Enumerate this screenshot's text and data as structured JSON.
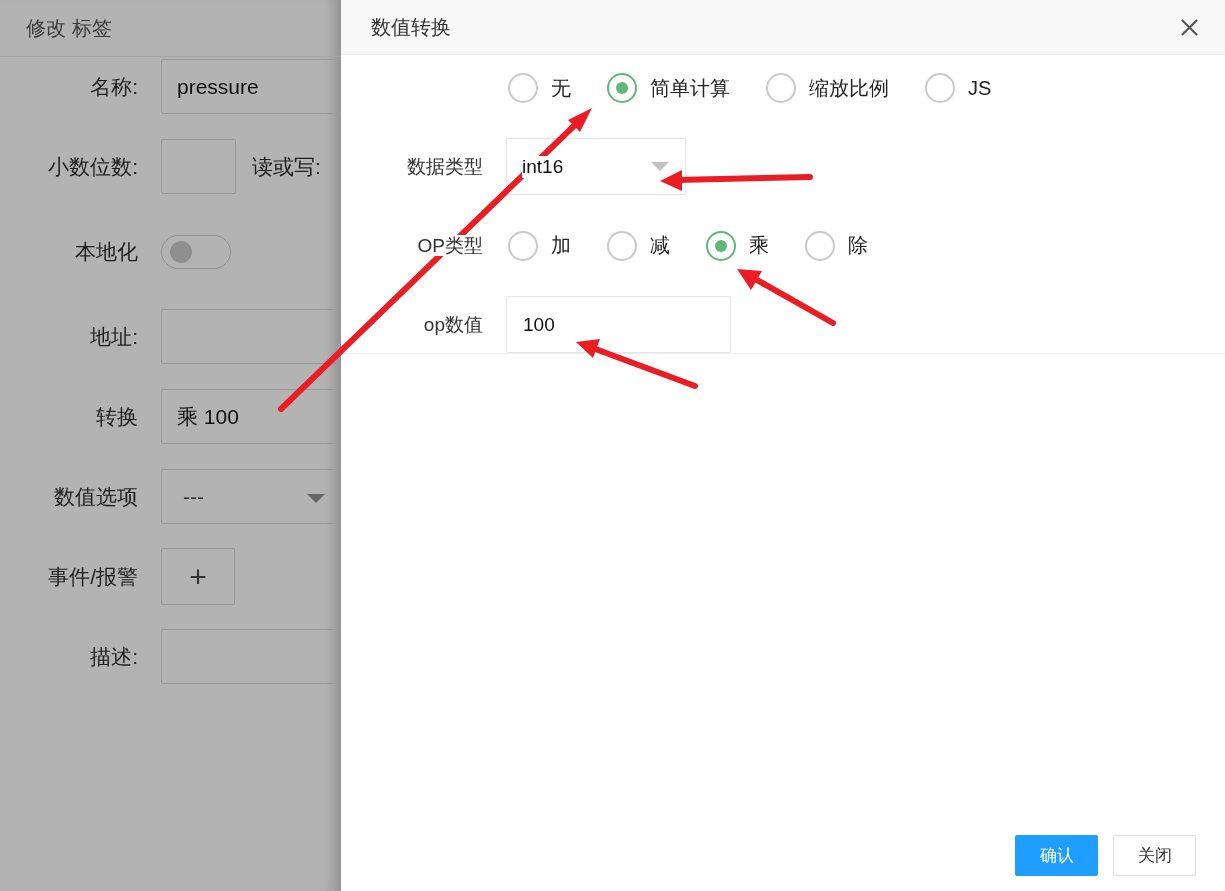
{
  "background_form": {
    "title": "修改 标签",
    "rows": [
      {
        "kind": "input",
        "label": "名称:",
        "value": "pressure"
      },
      {
        "kind": "narrow",
        "label": "小数位数:",
        "side_label": "读或写:"
      },
      {
        "kind": "toggle",
        "label": "本地化",
        "on": false
      },
      {
        "kind": "input",
        "label": "地址:"
      },
      {
        "kind": "input",
        "label": "转换",
        "value": "乘 100"
      },
      {
        "kind": "select",
        "label": "数值选项",
        "value": "---"
      },
      {
        "kind": "add",
        "label": "事件/报警",
        "symbol": "+"
      },
      {
        "kind": "input",
        "label": "描述:"
      }
    ]
  },
  "dialog": {
    "title": "数值转换",
    "modes": [
      {
        "label": "无",
        "selected": false
      },
      {
        "label": "简单计算",
        "selected": true
      },
      {
        "label": "缩放比例",
        "selected": false
      },
      {
        "label": "JS",
        "selected": false
      }
    ],
    "data_type": {
      "label": "数据类型",
      "value": "int16"
    },
    "op_type": {
      "label": "OP类型",
      "options": [
        {
          "label": "加",
          "selected": false
        },
        {
          "label": "减",
          "selected": false
        },
        {
          "label": "乘",
          "selected": true
        },
        {
          "label": "除",
          "selected": false
        }
      ]
    },
    "op_value": {
      "label": "op数值",
      "value": "100"
    },
    "buttons": [
      {
        "label": "确认",
        "kind": "primary"
      },
      {
        "label": "关闭",
        "kind": "default"
      }
    ]
  }
}
